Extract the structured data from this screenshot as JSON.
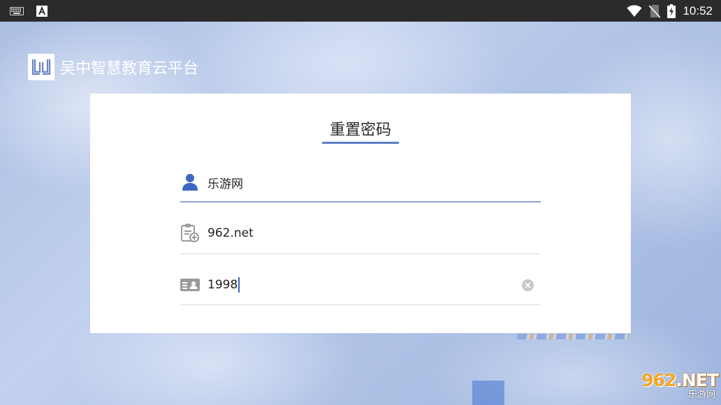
{
  "status_bar": {
    "time": "10:52",
    "icons": [
      "keyboard-icon",
      "a-notification-icon",
      "wifi-icon",
      "no-sim-icon",
      "battery-charging-icon"
    ]
  },
  "brand": {
    "name": "吴中智慧教育云平台",
    "logo_icon": "book-logo-icon"
  },
  "form": {
    "title": "重置密码",
    "fields": [
      {
        "icon": "user-icon",
        "value": "乐游网"
      },
      {
        "icon": "clipboard-add-icon",
        "value": "962.net"
      },
      {
        "icon": "id-card-icon",
        "value": "1998"
      }
    ],
    "clear_icon": "clear-icon"
  },
  "watermark": {
    "top_number": "962",
    "top_suffix": ".NET",
    "bottom": "乐游网"
  },
  "colors": {
    "accent": "#5b7fc7",
    "status_bar": "#2b2b2b",
    "icon_gray": "#9a9a9a",
    "icon_blue": "#3b66c4"
  }
}
